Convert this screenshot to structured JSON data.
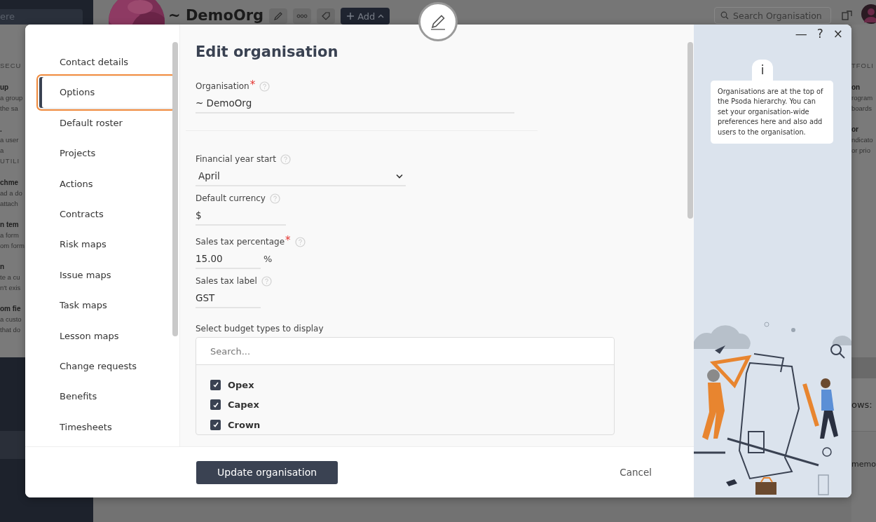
{
  "background": {
    "top_bar": {
      "search_fragment": "ere",
      "org_name": "~ DemoOrg",
      "add_button": "Add",
      "search_placeholder": "Search Organisation"
    },
    "left_fragments": [
      {
        "kind": "heading",
        "text": "SECU"
      },
      {
        "kind": "title",
        "text": "up"
      },
      {
        "kind": "text",
        "text": "a group"
      },
      {
        "kind": "text",
        "text": "the sa"
      },
      {
        "kind": "title",
        "text": "."
      },
      {
        "kind": "text",
        "text": "a user"
      },
      {
        "kind": "text",
        "text": "a"
      },
      {
        "kind": "heading",
        "text": "UTILI"
      },
      {
        "kind": "title",
        "text": "chme"
      },
      {
        "kind": "text",
        "text": "ad a do"
      },
      {
        "kind": "text",
        "text": "attach"
      },
      {
        "kind": "title",
        "text": "n tem"
      },
      {
        "kind": "text",
        "text": "a form"
      },
      {
        "kind": "text",
        "text": "om form"
      },
      {
        "kind": "title",
        "text": "n"
      },
      {
        "kind": "text",
        "text": "te a cu"
      },
      {
        "kind": "text",
        "text": "n't exis"
      },
      {
        "kind": "title",
        "text": "om fie"
      },
      {
        "kind": "text",
        "text": "a custo"
      },
      {
        "kind": "text",
        "text": "that do"
      }
    ],
    "right_fragments": [
      {
        "kind": "heading",
        "text": "TFOLI"
      },
      {
        "kind": "title",
        "text": "on"
      },
      {
        "kind": "text",
        "text": "rogram"
      },
      {
        "kind": "text",
        "text": "boards"
      },
      {
        "kind": "title",
        "text": "or"
      },
      {
        "kind": "text",
        "text": "ndicato"
      },
      {
        "kind": "text",
        "text": "or prio"
      }
    ],
    "rows_label": "ows:",
    "memo_fragment": "memo"
  },
  "modal": {
    "title": "Edit organisation",
    "window_controls": [
      "—",
      "?",
      "×"
    ],
    "nav": [
      {
        "label": "Contact details",
        "selected": false,
        "highlighted": false
      },
      {
        "label": "Options",
        "selected": true,
        "highlighted": true
      },
      {
        "label": "Default roster",
        "selected": false,
        "highlighted": false
      },
      {
        "label": "Projects",
        "selected": false,
        "highlighted": false
      },
      {
        "label": "Actions",
        "selected": false,
        "highlighted": false
      },
      {
        "label": "Contracts",
        "selected": false,
        "highlighted": false
      },
      {
        "label": "Risk maps",
        "selected": false,
        "highlighted": false
      },
      {
        "label": "Issue maps",
        "selected": false,
        "highlighted": false
      },
      {
        "label": "Task maps",
        "selected": false,
        "highlighted": false
      },
      {
        "label": "Lesson maps",
        "selected": false,
        "highlighted": false
      },
      {
        "label": "Change requests",
        "selected": false,
        "highlighted": false
      },
      {
        "label": "Benefits",
        "selected": false,
        "highlighted": false
      },
      {
        "label": "Timesheets",
        "selected": false,
        "highlighted": false
      }
    ],
    "sections": [
      {
        "fields": [
          {
            "kind": "text",
            "label": "Organisation",
            "required_mark": "*",
            "value": "~ DemoOrg"
          }
        ]
      },
      {
        "fields": [
          {
            "kind": "select",
            "label": "Financial year start",
            "value": "April"
          },
          {
            "kind": "text",
            "label": "Default currency",
            "value": "$"
          }
        ]
      },
      {
        "fields": [
          {
            "kind": "text",
            "label": "Sales tax percentage",
            "required_mark": "*",
            "value": "15.00",
            "suffix": "%"
          },
          {
            "kind": "text",
            "label": "Sales tax label",
            "value": "GST"
          }
        ]
      }
    ],
    "budget_types": {
      "label": "Select budget types to display",
      "search_placeholder": "Search...",
      "items": [
        {
          "label": "Opex",
          "checked": true
        },
        {
          "label": "Capex",
          "checked": true
        },
        {
          "label": "Crown",
          "checked": true
        }
      ]
    },
    "info": {
      "icon_text": "i",
      "text": "Organisations are at the top of the Psoda hierarchy. You can set your organisation-wide preferences here and also add users to the organisation."
    },
    "footer": {
      "submit": "Update organisation",
      "cancel": "Cancel"
    }
  }
}
